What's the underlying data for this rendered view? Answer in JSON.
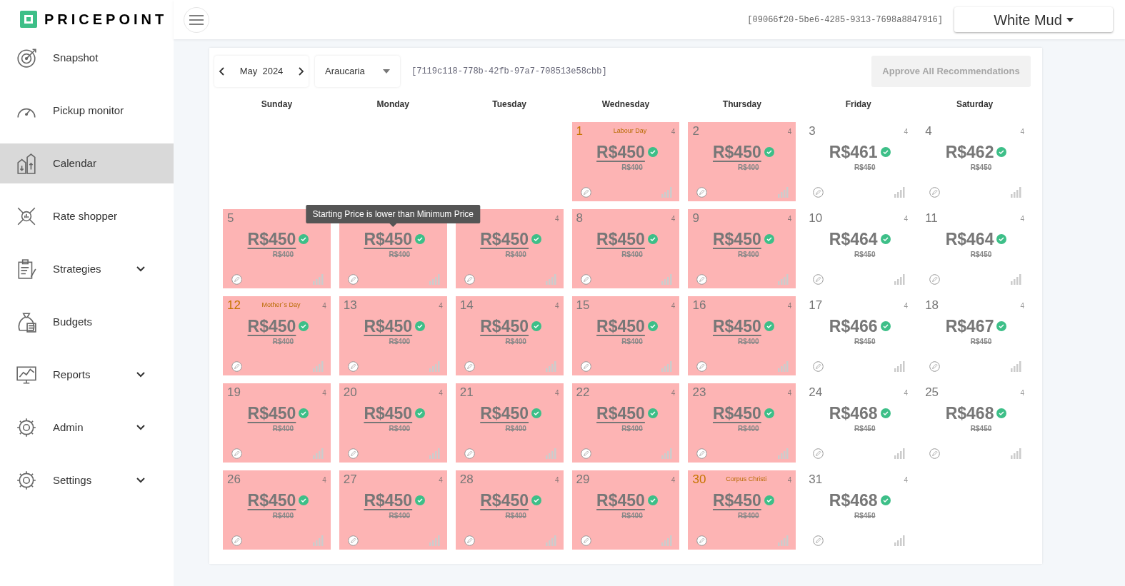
{
  "brand": "PRICEPOINT",
  "sidebar": {
    "items": [
      {
        "label": "Snapshot",
        "kind": "target",
        "selected": false,
        "has_submenu": false
      },
      {
        "label": "Pickup monitor",
        "kind": "gauge",
        "selected": false,
        "has_submenu": false
      },
      {
        "label": "Calendar",
        "kind": "buildings",
        "selected": true,
        "has_submenu": false
      },
      {
        "label": "Rate shopper",
        "kind": "network",
        "selected": false,
        "has_submenu": false
      },
      {
        "label": "Strategies",
        "kind": "clipboard",
        "selected": false,
        "has_submenu": true
      },
      {
        "label": "Budgets",
        "kind": "moneybag",
        "selected": false,
        "has_submenu": false
      },
      {
        "label": "Reports",
        "kind": "chart",
        "selected": false,
        "has_submenu": true
      },
      {
        "label": "Admin",
        "kind": "gear",
        "selected": false,
        "has_submenu": true
      },
      {
        "label": "Settings",
        "kind": "gear",
        "selected": false,
        "has_submenu": true
      }
    ]
  },
  "header": {
    "id_text": "[09066f20-5be6-4285-9313-7698a8847916]",
    "property": "White Mud"
  },
  "toolbar": {
    "month": "May",
    "year": "2024",
    "location": "Araucaria",
    "id_text": "[7119c118-778b-42fb-97a7-708513e58cbb]",
    "approve_button": {
      "label": "Approve All Recommendations",
      "disabled": true
    }
  },
  "weekdays": [
    "Sunday",
    "Monday",
    "Tuesday",
    "Wednesday",
    "Thursday",
    "Friday",
    "Saturday"
  ],
  "weeks": [
    [
      {
        "kind": "empty"
      },
      {
        "kind": "empty"
      },
      {
        "kind": "empty"
      },
      {
        "kind": "day",
        "day": "1",
        "holiday": "Labour Day",
        "count": "4",
        "price": "R$450",
        "old_price": "R$400",
        "below_min": true
      },
      {
        "kind": "day",
        "day": "2",
        "count": "4",
        "price": "R$450",
        "old_price": "R$400",
        "below_min": true
      },
      {
        "kind": "day",
        "day": "3",
        "count": "4",
        "price": "R$461",
        "old_price": "R$450",
        "below_min": false
      },
      {
        "kind": "day",
        "day": "4",
        "count": "4",
        "price": "R$462",
        "old_price": "R$450",
        "below_min": false
      }
    ],
    [
      {
        "kind": "day",
        "day": "5",
        "price": "R$450",
        "old_price": "R$400",
        "below_min": true
      },
      {
        "kind": "day",
        "price": "R$450",
        "old_price": "R$400",
        "below_min": true,
        "tooltip": "Starting Price is lower than Minimum Price"
      },
      {
        "kind": "day",
        "count": "4",
        "price": "R$450",
        "old_price": "R$400",
        "below_min": true
      },
      {
        "kind": "day",
        "day": "8",
        "count": "4",
        "price": "R$450",
        "old_price": "R$400",
        "below_min": true
      },
      {
        "kind": "day",
        "day": "9",
        "count": "4",
        "price": "R$450",
        "old_price": "R$400",
        "below_min": true
      },
      {
        "kind": "day",
        "day": "10",
        "count": "4",
        "price": "R$464",
        "old_price": "R$450",
        "below_min": false
      },
      {
        "kind": "day",
        "day": "11",
        "count": "4",
        "price": "R$464",
        "old_price": "R$450",
        "below_min": false
      }
    ],
    [
      {
        "kind": "day",
        "day": "12",
        "holiday": "Mother`s Day",
        "count": "4",
        "price": "R$450",
        "old_price": "R$400",
        "below_min": true
      },
      {
        "kind": "day",
        "day": "13",
        "count": "4",
        "price": "R$450",
        "old_price": "R$400",
        "below_min": true
      },
      {
        "kind": "day",
        "day": "14",
        "count": "4",
        "price": "R$450",
        "old_price": "R$400",
        "below_min": true
      },
      {
        "kind": "day",
        "day": "15",
        "count": "4",
        "price": "R$450",
        "old_price": "R$400",
        "below_min": true
      },
      {
        "kind": "day",
        "day": "16",
        "count": "4",
        "price": "R$450",
        "old_price": "R$400",
        "below_min": true
      },
      {
        "kind": "day",
        "day": "17",
        "count": "4",
        "price": "R$466",
        "old_price": "R$450",
        "below_min": false
      },
      {
        "kind": "day",
        "day": "18",
        "count": "4",
        "price": "R$467",
        "old_price": "R$450",
        "below_min": false
      }
    ],
    [
      {
        "kind": "day",
        "day": "19",
        "count": "4",
        "price": "R$450",
        "old_price": "R$400",
        "below_min": true
      },
      {
        "kind": "day",
        "day": "20",
        "count": "4",
        "price": "R$450",
        "old_price": "R$400",
        "below_min": true
      },
      {
        "kind": "day",
        "day": "21",
        "count": "4",
        "price": "R$450",
        "old_price": "R$400",
        "below_min": true
      },
      {
        "kind": "day",
        "day": "22",
        "count": "4",
        "price": "R$450",
        "old_price": "R$400",
        "below_min": true
      },
      {
        "kind": "day",
        "day": "23",
        "count": "4",
        "price": "R$450",
        "old_price": "R$400",
        "below_min": true
      },
      {
        "kind": "day",
        "day": "24",
        "count": "4",
        "price": "R$468",
        "old_price": "R$450",
        "below_min": false
      },
      {
        "kind": "day",
        "day": "25",
        "count": "4",
        "price": "R$468",
        "old_price": "R$450",
        "below_min": false
      }
    ],
    [
      {
        "kind": "day",
        "day": "26",
        "count": "4",
        "price": "R$450",
        "old_price": "R$400",
        "below_min": true
      },
      {
        "kind": "day",
        "day": "27",
        "count": "4",
        "price": "R$450",
        "old_price": "R$400",
        "below_min": true
      },
      {
        "kind": "day",
        "day": "28",
        "count": "4",
        "price": "R$450",
        "old_price": "R$400",
        "below_min": true
      },
      {
        "kind": "day",
        "day": "29",
        "count": "4",
        "price": "R$450",
        "old_price": "R$400",
        "below_min": true
      },
      {
        "kind": "day",
        "day": "30",
        "holiday": "Corpus Christi",
        "count": "4",
        "price": "R$450",
        "old_price": "R$400",
        "below_min": true
      },
      {
        "kind": "day",
        "day": "31",
        "count": "4",
        "price": "R$468",
        "old_price": "R$450",
        "below_min": false
      },
      {
        "kind": "empty"
      }
    ]
  ]
}
